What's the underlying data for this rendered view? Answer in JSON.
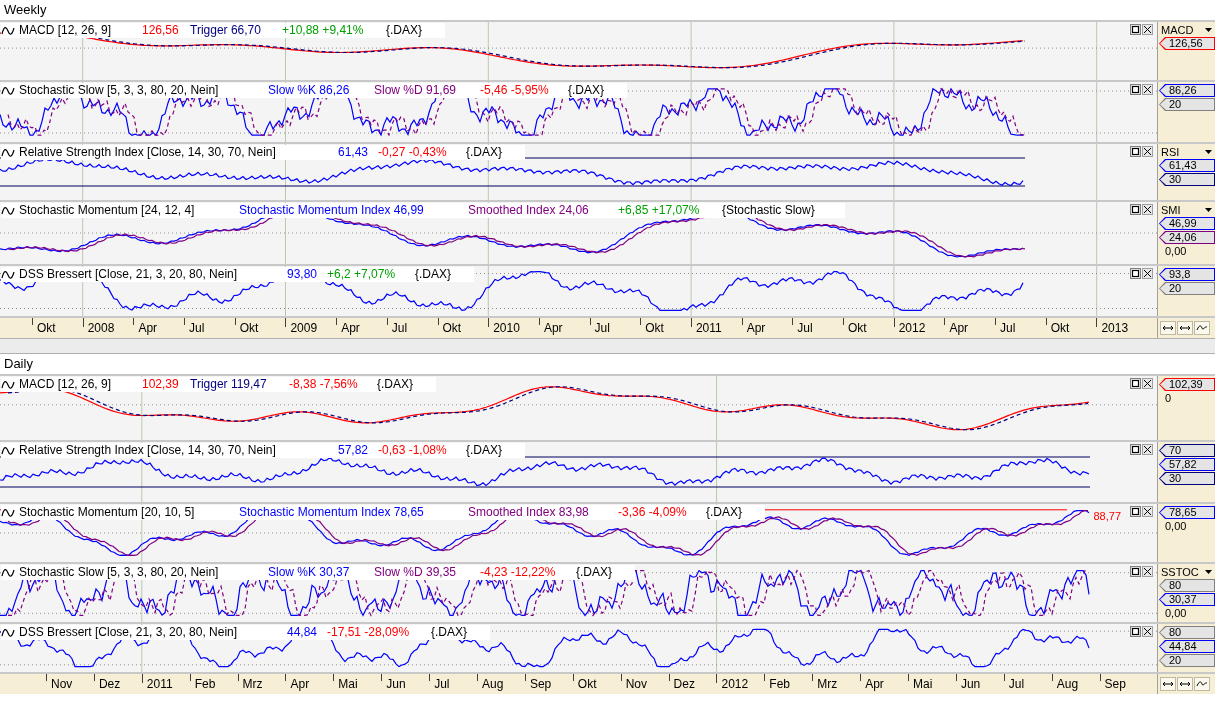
{
  "sections": [
    {
      "title": "Weekly",
      "panes": [
        {
          "kind": "macd",
          "header": [
            {
              "text": "MACD [12, 26, 9]",
              "color": "#000000"
            },
            {
              "text": "126,56",
              "color": "#ff0000"
            },
            {
              "text": "Trigger 66,70",
              "color": "#000080"
            },
            {
              "text": "+10,88 +9,41%",
              "color": "#00a000"
            },
            {
              "text": "{.DAX}",
              "color": "#000000"
            }
          ],
          "lines": [
            {
              "color": "#ff0000"
            },
            {
              "color": "#000080"
            }
          ],
          "scale": [
            {
              "kind": "label",
              "text": "MACD"
            },
            {
              "kind": "tag",
              "text": "126,56",
              "color": "#ff0000"
            }
          ]
        },
        {
          "kind": "stoch",
          "header": [
            {
              "text": "Stochastic Slow [5, 3, 3, 80, 20, Nein]",
              "color": "#000000"
            },
            {
              "text": "Slow %K 86,26",
              "color": "#0000ff"
            },
            {
              "text": "Slow %D 91,69",
              "color": "#800080"
            },
            {
              "text": "-5,46 -5,95%",
              "color": "#ff0000"
            },
            {
              "text": "{.DAX}",
              "color": "#000000"
            }
          ],
          "lines": [
            {
              "color": "#0000ff"
            },
            {
              "color": "#800080"
            }
          ],
          "scale": [
            {
              "kind": "tag",
              "text": "86,26",
              "color": "#0000ff"
            },
            {
              "kind": "tag",
              "text": "20",
              "color": "#808080"
            }
          ]
        },
        {
          "kind": "rsi",
          "header": [
            {
              "text": "Relative Strength Index [Close, 14, 30, 70, Nein]",
              "color": "#000000"
            },
            {
              "text": "61,43",
              "color": "#0000ff"
            },
            {
              "text": "-0,27 -0,43%",
              "color": "#ff0000"
            },
            {
              "text": "{.DAX}",
              "color": "#000000"
            }
          ],
          "lines": [
            {
              "color": "#0000ff"
            }
          ],
          "scale": [
            {
              "kind": "label",
              "text": "RSI"
            },
            {
              "kind": "tag",
              "text": "61,43",
              "color": "#0000ff"
            },
            {
              "kind": "tag",
              "text": "30",
              "color": "#000080"
            }
          ]
        },
        {
          "kind": "smi",
          "header": [
            {
              "text": "Stochastic Momentum [24, 12, 4]",
              "color": "#000000"
            },
            {
              "text": "Stochastic Momentum Index 46,99",
              "color": "#0000ff"
            },
            {
              "text": "Smoothed Index 24,06",
              "color": "#800080"
            },
            {
              "text": "+6,85 +17,07%",
              "color": "#00a000"
            },
            {
              "text": "{Stochastic Slow}",
              "color": "#000000"
            }
          ],
          "lines": [
            {
              "color": "#0000ff"
            },
            {
              "color": "#800080"
            }
          ],
          "scale": [
            {
              "kind": "label",
              "text": "SMI"
            },
            {
              "kind": "tag",
              "text": "46,99",
              "color": "#0000ff"
            },
            {
              "kind": "tag",
              "text": "24,06",
              "color": "#800080"
            },
            {
              "kind": "tick",
              "text": "0,00"
            }
          ]
        },
        {
          "kind": "dss",
          "header": [
            {
              "text": "DSS Bressert [Close, 21, 3, 20, 80, Nein]",
              "color": "#000000"
            },
            {
              "text": "93,80",
              "color": "#0000ff"
            },
            {
              "text": "+6,2 +7,07%",
              "color": "#00a000"
            },
            {
              "text": "{.DAX}",
              "color": "#000000"
            }
          ],
          "lines": [
            {
              "color": "#0000ff"
            }
          ],
          "scale": [
            {
              "kind": "tag",
              "text": "93,8",
              "color": "#0000ff"
            },
            {
              "kind": "tag",
              "text": "20",
              "color": "#808080"
            }
          ]
        }
      ],
      "axis": [
        {
          "text": "Okt",
          "kind": "month"
        },
        {
          "text": "2008",
          "kind": "year"
        },
        {
          "text": "Apr",
          "kind": "month"
        },
        {
          "text": "Jul",
          "kind": "month"
        },
        {
          "text": "Okt",
          "kind": "month"
        },
        {
          "text": "2009",
          "kind": "year"
        },
        {
          "text": "Apr",
          "kind": "month"
        },
        {
          "text": "Jul",
          "kind": "month"
        },
        {
          "text": "Okt",
          "kind": "month"
        },
        {
          "text": "2010",
          "kind": "year"
        },
        {
          "text": "Apr",
          "kind": "month"
        },
        {
          "text": "Jul",
          "kind": "month"
        },
        {
          "text": "Okt",
          "kind": "month"
        },
        {
          "text": "2011",
          "kind": "year"
        },
        {
          "text": "Apr",
          "kind": "month"
        },
        {
          "text": "Jul",
          "kind": "month"
        },
        {
          "text": "Okt",
          "kind": "month"
        },
        {
          "text": "2012",
          "kind": "year"
        },
        {
          "text": "Apr",
          "kind": "month"
        },
        {
          "text": "Jul",
          "kind": "month"
        },
        {
          "text": "Okt",
          "kind": "month"
        },
        {
          "text": "2013",
          "kind": "year"
        }
      ]
    },
    {
      "title": "Daily",
      "panes": [
        {
          "kind": "macd",
          "header": [
            {
              "text": "MACD [12, 26, 9]",
              "color": "#000000"
            },
            {
              "text": "102,39",
              "color": "#ff0000"
            },
            {
              "text": "Trigger 119,47",
              "color": "#000080"
            },
            {
              "text": "-8,38 -7,56%",
              "color": "#ff0000"
            },
            {
              "text": "{.DAX}",
              "color": "#000000"
            }
          ],
          "lines": [
            {
              "color": "#ff0000"
            },
            {
              "color": "#000080"
            }
          ],
          "scale": [
            {
              "kind": "tag",
              "text": "102,39",
              "color": "#ff0000"
            },
            {
              "kind": "tick",
              "text": "0"
            }
          ]
        },
        {
          "kind": "rsi",
          "header": [
            {
              "text": "Relative Strength Index [Close, 14, 30, 70, Nein]",
              "color": "#000000"
            },
            {
              "text": "57,82",
              "color": "#0000ff"
            },
            {
              "text": "-0,63 -1,08%",
              "color": "#ff0000"
            },
            {
              "text": "{.DAX}",
              "color": "#000000"
            }
          ],
          "lines": [
            {
              "color": "#0000ff"
            }
          ],
          "scale": [
            {
              "kind": "tag",
              "text": "70",
              "color": "#000080"
            },
            {
              "kind": "tag",
              "text": "57,82",
              "color": "#0000ff"
            },
            {
              "kind": "tag",
              "text": "30",
              "color": "#000080"
            }
          ]
        },
        {
          "kind": "smi",
          "header": [
            {
              "text": "Stochastic Momentum [20, 10, 5]",
              "color": "#000000"
            },
            {
              "text": "Stochastic Momentum Index 78,65",
              "color": "#0000ff"
            },
            {
              "text": "Smoothed Index 83,98",
              "color": "#800080"
            },
            {
              "text": "-3,36 -4,09%",
              "color": "#ff0000"
            },
            {
              "text": "{.DAX}",
              "color": "#000000"
            }
          ],
          "lines": [
            {
              "color": "#0000ff"
            },
            {
              "color": "#800080"
            }
          ],
          "marker": {
            "text": "88,77",
            "color": "#ff0000"
          },
          "scale": [
            {
              "kind": "tag",
              "text": "78,65",
              "color": "#0000ff"
            },
            {
              "kind": "tick",
              "text": "0,00"
            }
          ]
        },
        {
          "kind": "stoch",
          "header": [
            {
              "text": "Stochastic Slow [5, 3, 3, 80, 20, Nein]",
              "color": "#000000"
            },
            {
              "text": "Slow %K 30,37",
              "color": "#0000ff"
            },
            {
              "text": "Slow %D 39,35",
              "color": "#800080"
            },
            {
              "text": "-4,23 -12,22%",
              "color": "#ff0000"
            },
            {
              "text": "{.DAX}",
              "color": "#000000"
            }
          ],
          "lines": [
            {
              "color": "#0000ff"
            },
            {
              "color": "#800080"
            }
          ],
          "scale": [
            {
              "kind": "label",
              "text": "SSTOC"
            },
            {
              "kind": "tag",
              "text": "80",
              "color": "#808080"
            },
            {
              "kind": "tag",
              "text": "30,37",
              "color": "#0000ff"
            },
            {
              "kind": "tick",
              "text": "0,00"
            }
          ]
        },
        {
          "kind": "dss",
          "header": [
            {
              "text": "DSS Bressert [Close, 21, 3, 20, 80, Nein]",
              "color": "#000000"
            },
            {
              "text": "44,84",
              "color": "#0000ff"
            },
            {
              "text": "-17,51 -28,09%",
              "color": "#ff0000"
            },
            {
              "text": "{.DAX}",
              "color": "#000000"
            }
          ],
          "lines": [
            {
              "color": "#0000ff"
            }
          ],
          "scale": [
            {
              "kind": "tag",
              "text": "80",
              "color": "#808080"
            },
            {
              "kind": "tag",
              "text": "44,84",
              "color": "#0000ff"
            },
            {
              "kind": "tag",
              "text": "20",
              "color": "#808080"
            }
          ]
        }
      ],
      "axis": [
        {
          "text": "Nov",
          "kind": "month"
        },
        {
          "text": "Dez",
          "kind": "month"
        },
        {
          "text": "2011",
          "kind": "year"
        },
        {
          "text": "Feb",
          "kind": "month"
        },
        {
          "text": "Mrz",
          "kind": "month"
        },
        {
          "text": "Apr",
          "kind": "month"
        },
        {
          "text": "Mai",
          "kind": "month"
        },
        {
          "text": "Jun",
          "kind": "month"
        },
        {
          "text": "Jul",
          "kind": "month"
        },
        {
          "text": "Aug",
          "kind": "month"
        },
        {
          "text": "Sep",
          "kind": "month"
        },
        {
          "text": "Okt",
          "kind": "month"
        },
        {
          "text": "Nov",
          "kind": "month"
        },
        {
          "text": "Dez",
          "kind": "month"
        },
        {
          "text": "2012",
          "kind": "year"
        },
        {
          "text": "Feb",
          "kind": "month"
        },
        {
          "text": "Mrz",
          "kind": "month"
        },
        {
          "text": "Apr",
          "kind": "month"
        },
        {
          "text": "Mai",
          "kind": "month"
        },
        {
          "text": "Jun",
          "kind": "month"
        },
        {
          "text": "Jul",
          "kind": "month"
        },
        {
          "text": "Aug",
          "kind": "month"
        },
        {
          "text": "Sep",
          "kind": "month"
        }
      ]
    }
  ]
}
